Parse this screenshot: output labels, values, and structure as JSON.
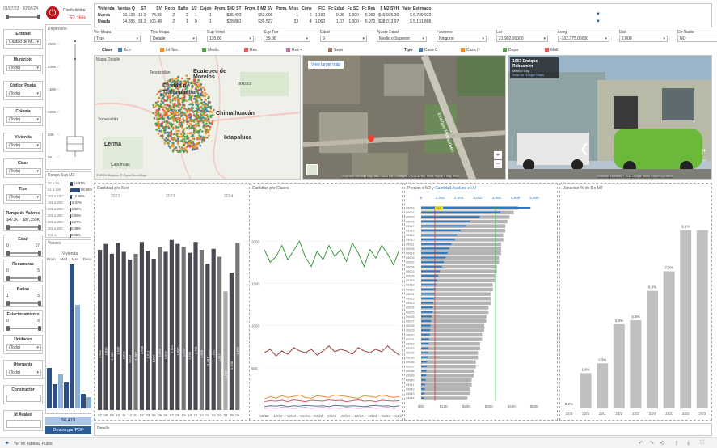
{
  "dates": {
    "start": "01/07/22",
    "end": "30/06/24"
  },
  "confiabilidad": {
    "label": "Confiabilidad",
    "value": "57.16%"
  },
  "kpi": {
    "headers": [
      "Vivienda",
      "Ventas Q",
      "ST",
      "SV",
      "Reco",
      "Baño",
      "1/2",
      "Cajon",
      "Prom. $M2 ST",
      "Prom. $ M2 SV",
      "Prom. Años",
      "Cons",
      "FIC",
      "Fc Edad",
      "Fc SC",
      "Fc Res",
      "$ M2 SVH",
      "Valor Estimado"
    ],
    "rows": [
      [
        "Nueva",
        "16,133",
        "19.9",
        "74.86",
        "2",
        "2",
        "1",
        "1",
        "$35,493",
        "$52,006",
        "1",
        "6",
        "1.160",
        "0.96",
        "1.000",
        "0.960",
        "$49,925.30",
        "$ 6,739,922"
      ],
      [
        "Usada",
        "34,286",
        "38.3",
        "106.48",
        "2",
        "1",
        "0",
        "1",
        "$28,881",
        "$35,527",
        "23",
        "4",
        "1.000",
        "1.07",
        "1.000",
        "0.970",
        "$38,013.97",
        "$ 5,131,886"
      ]
    ]
  },
  "params": [
    {
      "label": "Ver Mapa",
      "value": "True"
    },
    {
      "label": "Tipo Mapa",
      "value": "Detalle"
    },
    {
      "label": "Sup Vend",
      "value": "135.00"
    },
    {
      "label": "Sup Terr",
      "value": "39.90"
    },
    {
      "label": "Edad",
      "value": "9"
    },
    {
      "label": "Ajuste Edad",
      "value": "Medio o Superior"
    },
    {
      "label": "Factpres",
      "value": "Ninguno"
    },
    {
      "label": "Lat",
      "value": "21.902.00000"
    },
    {
      "label": "Long",
      "value": "-102.275.00000"
    },
    {
      "label": "Dist",
      "value": "2,000"
    },
    {
      "label": "En Radio",
      "value": "NO"
    }
  ],
  "legend_clase": {
    "title": "Clase",
    "items": [
      {
        "name": "Eco",
        "color": "#4e79a7"
      },
      {
        "name": "Int Soc",
        "color": "#f28e2b"
      },
      {
        "name": "Medio",
        "color": "#59a14f"
      },
      {
        "name": "Res",
        "color": "#e15759"
      },
      {
        "name": "Res +",
        "color": "#b07aa1"
      },
      {
        "name": "Semi",
        "color": "#9c755f"
      }
    ]
  },
  "legend_tipo": {
    "title": "Tipo",
    "items": [
      {
        "name": "Casa C",
        "color": "#4e79a7"
      },
      {
        "name": "Casa H",
        "color": "#f28e2b"
      },
      {
        "name": "Depa",
        "color": "#59a14f"
      },
      {
        "name": "Mult",
        "color": "#e15759"
      }
    ]
  },
  "filters": {
    "entidad": {
      "title": "Entidad",
      "value": "Ciudad de M..."
    },
    "municipio": {
      "title": "Municipio",
      "value": "(Todo)"
    },
    "cp": {
      "title": "Código Postal",
      "value": "(Todo)"
    },
    "colonia": {
      "title": "Colonia",
      "value": "(Todo)"
    },
    "vivienda": {
      "title": "Vivienda",
      "value": "(Todo)"
    },
    "clase": {
      "title": "Clase",
      "value": "(Todo)"
    },
    "tipo": {
      "title": "Tipo",
      "value": "(Todo)"
    },
    "rango": {
      "title": "Rango de Valores",
      "min": "$473K",
      "max": "$87,359K"
    },
    "edad": {
      "title": "Edad",
      "min": "0",
      "max": "17"
    },
    "recamaras": {
      "title": "Recamaras",
      "min": "0",
      "max": "5"
    },
    "banos": {
      "title": "Baños",
      "min": "1",
      "max": "5"
    },
    "estac": {
      "title": "Estacionamiento",
      "min": "0",
      "max": "6"
    },
    "unidades": {
      "title": "Unidades",
      "value": "(Todo)"
    },
    "otorgante": {
      "title": "Otorgante",
      "value": "(Todo)"
    },
    "constructor": {
      "title": "Constructor",
      "value": ""
    },
    "idavaluo": {
      "title": "Id Avaluo",
      "value": ""
    }
  },
  "dispersion": {
    "title": "Dispersión",
    "ticks": [
      "250K",
      "200K",
      "150K",
      "100K",
      "50K",
      "0K"
    ]
  },
  "rango_sup": {
    "title": "Rango Sup M2",
    "rows": [
      {
        "label": "30 a 50",
        "pct": "14.67%",
        "frac": 0.25
      },
      {
        "label": "51 a 100",
        "pct": "58.56%",
        "frac": 1.0
      },
      {
        "label": "101 a 150",
        "pct": "12.05%",
        "frac": 0.2
      },
      {
        "label": "151 a 200",
        "pct": "5.37%",
        "frac": 0.09
      },
      {
        "label": "201 a 250",
        "pct": "2.86%",
        "frac": 0.05
      },
      {
        "label": "251 a 300",
        "pct": "2.06%",
        "frac": 0.035
      },
      {
        "label": "301 a 350",
        "pct": "2.27%",
        "frac": 0.04
      },
      {
        "label": "351 a 500",
        "pct": "0.49%",
        "frac": 0.01
      },
      {
        "label": "501 a",
        "pct": "0.05%",
        "frac": 0.002
      }
    ]
  },
  "valores": {
    "title": "Valores",
    "subtitle": "Vivienda",
    "cols": [
      "Prom",
      "Med",
      "Max",
      "Desv"
    ]
  },
  "valor_total": "50,419",
  "download_label": "Descargar PDF",
  "map_detail_title": "Mapa Detalle",
  "map_labels": {
    "ecatepec": "Ecatepec de Morelos",
    "tlalnepantla": "Ciudad de Tlalnepantla",
    "chimalhuacan": "Chimalhuacán",
    "ixtapaluca": "Ixtapaluca",
    "xonacatlan": "Xonacatlán",
    "lerma": "Lerma",
    "capulhuac": "Capulhuac",
    "tepotzotlan": "Tepotzotlán",
    "texcoco": "Texcoco",
    "attribution": "© 2024 Mapbox © OpenStreetMap"
  },
  "sat_map": {
    "button": "View larger map",
    "attribution": "Keyboard shortcuts  Map data ©2024 INEGI  Imagery ©2024 Airbus  Terms  Report a map error",
    "street": "Enrique Rébsamen"
  },
  "street_view": {
    "address": "1063 Enrique Rébsamen",
    "city": "Mexico City",
    "link": "View on Google Maps",
    "attribution": "Keyboard shortcuts  © 2024 Google  Terms  Report a problem"
  },
  "chart_mes": {
    "title": "Cantidad por Mes",
    "years": [
      "2022",
      "2023",
      "2024"
    ]
  },
  "chart_clases": {
    "title": "Cantidad por Clases",
    "yticks": [
      "2000",
      "1500",
      "1000",
      "500"
    ]
  },
  "chart_precios": {
    "title": "Precios x M2 y",
    "title2": "Cantidad Avaluos x UV",
    "axis": [
      "0",
      "1,000",
      "2,000",
      "3,000",
      "4,000",
      "5,000",
      "6,000"
    ],
    "bottom": [
      "$0K",
      "$10K",
      "$20K",
      "$30K",
      "$40K",
      "$50K"
    ],
    "badge": "763"
  },
  "chart_variacion": {
    "title": "Variación % de $ x M2"
  },
  "detalle_title": "Detalle",
  "footer": {
    "tableau": "Ver en Tableau Public"
  },
  "chart_data": [
    {
      "type": "bar",
      "title": "Cantidad por Mes",
      "categories": [
        "07",
        "08",
        "09",
        "10",
        "11",
        "12",
        "01",
        "02",
        "03",
        "04",
        "05",
        "06",
        "07",
        "08",
        "09",
        "10",
        "11",
        "12",
        "01",
        "02",
        "03",
        "04",
        "05",
        "06"
      ],
      "values": [
        1620,
        1680,
        1580,
        1690,
        1600,
        1520,
        1580,
        1700,
        1610,
        1530,
        1650,
        1600,
        1720,
        1680,
        1650,
        1590,
        1700,
        1620,
        1480,
        1630,
        1550,
        1200,
        1390,
        1690
      ],
      "labels": [
        "1,621",
        "1,690",
        "1,589",
        "1,695",
        "1,602",
        "1,520",
        "1,587",
        "1,698",
        "1,611",
        "1,535",
        "1,659",
        "1,603",
        "1,721",
        "1,685",
        "1,653",
        "1,598",
        "1,701",
        "1,628",
        "1,487",
        "1,632",
        "1,557",
        "1,203",
        "1,398",
        "1,690"
      ],
      "colors": [
        "#4a4a52",
        "#4a4a52",
        "#4a4a52",
        "#4a4a52",
        "#4a4a52",
        "#4a4a52",
        "#777",
        "#4a4a52",
        "#4a4a52",
        "#4a4a52",
        "#777",
        "#4a4a52",
        "#4a4a52",
        "#4a4a52",
        "#777",
        "#4a4a52",
        "#4a4a52",
        "#777",
        "#4a4a52",
        "#4a4a52",
        "#777",
        "#aaa",
        "#4a4a52",
        "#777"
      ]
    },
    {
      "type": "line",
      "title": "Cantidad por Clases",
      "x": [
        "08/22",
        "10/22",
        "12/22",
        "02/23",
        "04/23",
        "06/23",
        "08/23",
        "10/23",
        "12/23",
        "02/24",
        "04/24"
      ],
      "ylim": [
        0,
        2300
      ],
      "series": [
        {
          "name": "Medio",
          "color": "#3a9b3a",
          "values": [
            1900,
            1750,
            1820,
            1950,
            1780,
            1890,
            2000,
            1810,
            1700,
            1880,
            1780,
            1950,
            1820,
            1900,
            1760,
            1980,
            1860,
            1700,
            1900,
            1800,
            1950,
            1850,
            1720,
            1900
          ]
        },
        {
          "name": "Semi",
          "color": "#9b3a3a",
          "values": [
            680,
            720,
            640,
            700,
            660,
            740,
            700,
            680,
            720,
            650,
            700,
            760,
            690,
            720,
            700,
            660,
            740,
            700,
            680,
            720,
            690,
            760,
            700,
            650
          ]
        },
        {
          "name": "Int Soc",
          "color": "#f28e2b",
          "values": [
            130,
            160,
            140,
            170,
            150,
            160,
            180,
            150,
            140,
            170,
            160,
            150,
            180,
            170,
            160,
            150,
            140,
            170,
            160,
            150,
            180,
            165,
            150,
            160
          ]
        },
        {
          "name": "Res",
          "color": "#e15759",
          "values": [
            100,
            110,
            105,
            115,
            100,
            120,
            110,
            100,
            115,
            110,
            105,
            120,
            110,
            115,
            100,
            110,
            120,
            105,
            110,
            100,
            115,
            110,
            105,
            110
          ]
        },
        {
          "name": "Eco",
          "color": "#4e79a7",
          "values": [
            40,
            50,
            45,
            55,
            40,
            50,
            45,
            55,
            50,
            45,
            50,
            40,
            55,
            50,
            45,
            50,
            45,
            40,
            50,
            55,
            45,
            50,
            40,
            50
          ]
        },
        {
          "name": "Res +",
          "color": "#b07aa1",
          "values": [
            20,
            25,
            20,
            30,
            25,
            20,
            25,
            30,
            20,
            25,
            30,
            20,
            25,
            20,
            30,
            25,
            20,
            25,
            30,
            20,
            25,
            30,
            20,
            25
          ]
        }
      ]
    },
    {
      "type": "bar",
      "title": "Precios x M2 y Cantidad Avaluos x UV",
      "categories": [
        "09016",
        "09007",
        "09003",
        "09005",
        "09017",
        "09015",
        "09012",
        "09010",
        "09011",
        "09008",
        "09014",
        "09009",
        "09002",
        "09004",
        "09013",
        "09006",
        "09018",
        "09019",
        "09020",
        "09021",
        "09022",
        "09023",
        "09024",
        "09025",
        "09026",
        "09027",
        "09028",
        "09029",
        "09030",
        "09031",
        "09032",
        "09033",
        "09034",
        "09035",
        "09036",
        "09037",
        "09038",
        "09039",
        "09040",
        "09041",
        "09042",
        "09043",
        "09044"
      ],
      "price": [
        46,
        44,
        42,
        41,
        40,
        40,
        39,
        39,
        38,
        38,
        38,
        37,
        37,
        36,
        36,
        35,
        35,
        34,
        34,
        33,
        33,
        33,
        32,
        32,
        31,
        31,
        30,
        30,
        29,
        29,
        28,
        28,
        27,
        27,
        26,
        26,
        25,
        25,
        24,
        24,
        23,
        23,
        22
      ],
      "count": [
        5800,
        4200,
        3100,
        2600,
        2400,
        2100,
        1900,
        1800,
        1600,
        1500,
        1400,
        1300,
        1200,
        1100,
        1000,
        900,
        850,
        800,
        760,
        720,
        680,
        650,
        620,
        600,
        560,
        520,
        500,
        480,
        450,
        420,
        400,
        380,
        360,
        340,
        320,
        300,
        280,
        260,
        240,
        220,
        200,
        180,
        160
      ]
    },
    {
      "type": "bar",
      "title": "Variación % de $ x M2",
      "categories": [
        "22/3",
        "22/4",
        "23/1",
        "23/2",
        "23/3",
        "23/4",
        "24/1",
        "24/2",
        "24/3"
      ],
      "values": [
        0.0,
        1.8,
        2.3,
        4.3,
        4.5,
        6.0,
        7.0,
        9.1,
        9.1
      ],
      "labels": [
        "0.0%",
        "1.8%",
        "2.3%",
        "4.3%",
        "4.5%",
        "6.0%",
        "7.0%",
        "9.1%",
        ""
      ]
    }
  ]
}
